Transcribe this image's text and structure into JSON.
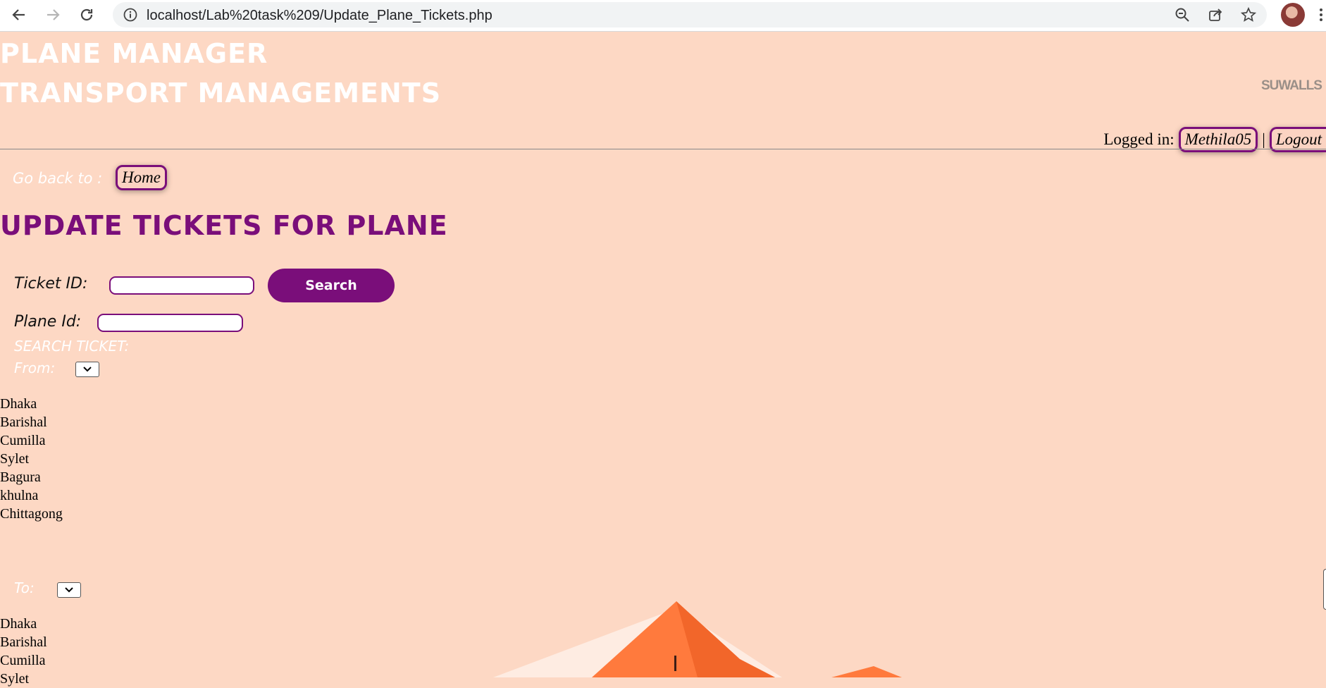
{
  "browser": {
    "url": "localhost/Lab%20task%209/Update_Plane_Tickets.php"
  },
  "header": {
    "title_line1": "PLANE MANAGER",
    "title_line2": "TRANSPORT MANAGEMENTS",
    "brand": "SUWALLS",
    "logged_in_label": "Logged in:",
    "username": "Methila05",
    "separator": "|",
    "logout_label": "Logout"
  },
  "nav": {
    "go_back_label": "Go back to :",
    "home_label": "Home"
  },
  "main": {
    "heading": "UPDATE TICKETS FOR PLANE",
    "ticket_id_label": "Ticket ID:",
    "ticket_id_value": "",
    "search_button": "Search",
    "plane_id_label": "Plane Id:",
    "plane_id_value": "",
    "search_ticket_label": "SEARCH TICKET:",
    "from_label": "From:",
    "to_label": "To:",
    "from_cities": [
      "Dhaka",
      "Barishal",
      "Cumilla",
      "Sylet",
      "Bagura",
      "khulna",
      "Chittagong"
    ],
    "to_cities": [
      "Dhaka",
      "Barishal",
      "Cumilla",
      "Sylet"
    ]
  },
  "colors": {
    "background": "#fdd8c4",
    "accent": "#7a0e7a",
    "mountain": "#ff7a3d"
  }
}
